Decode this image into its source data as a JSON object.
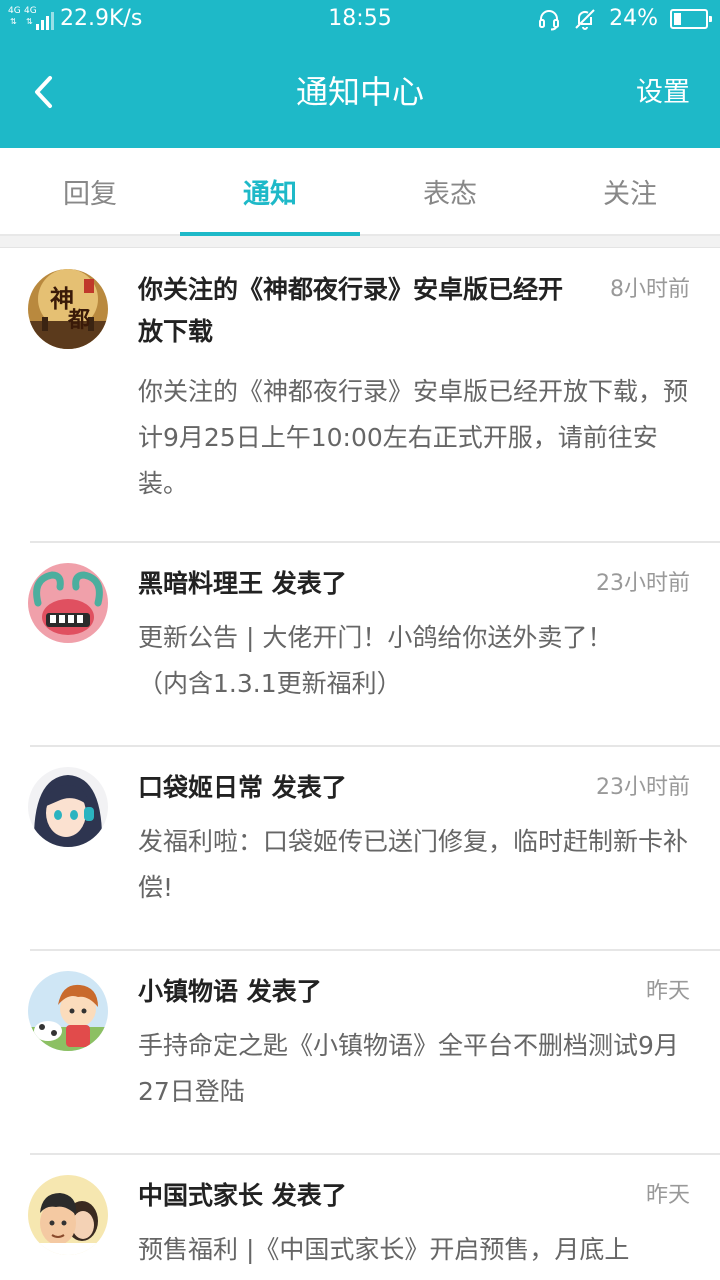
{
  "status_bar": {
    "network_1": "4G",
    "network_2": "4G",
    "net_speed": "22.9K/s",
    "time": "18:55",
    "battery_percent": "24%",
    "battery_level": 0.24,
    "icons": [
      "headset-icon",
      "silent-bell-icon",
      "battery-icon"
    ]
  },
  "header": {
    "back_icon": "chevron-left-icon",
    "title": "通知中心",
    "settings_label": "设置"
  },
  "colors": {
    "accent": "#1EB9C8",
    "title_text": "#222222",
    "body_text": "#666666",
    "time_text": "#999999"
  },
  "tabs": [
    {
      "label": "回复",
      "active": false
    },
    {
      "label": "通知",
      "active": true
    },
    {
      "label": "表态",
      "active": false
    },
    {
      "label": "关注",
      "active": false
    }
  ],
  "notifications": [
    {
      "avatar": "shendu-game-avatar",
      "title": "你关注的《神都夜行录》安卓版已经开放下载",
      "time": "8小时前",
      "body": "你关注的《神都夜行录》安卓版已经开放下载，预计9月25日上午10:00左右正式开服，请前往安装。"
    },
    {
      "avatar": "dark-chef-game-avatar",
      "title": "黑暗料理王 发表了",
      "time": "23小时前",
      "body": "更新公告 | 大佬开门！小鸽给你送外卖了！（内含1.3.1更新福利）"
    },
    {
      "avatar": "pocket-princess-game-avatar",
      "title": "口袋姬日常 发表了",
      "time": "23小时前",
      "body": "发福利啦：口袋姬传已送门修复，临时赶制新卡补偿!"
    },
    {
      "avatar": "town-story-game-avatar",
      "title": "小镇物语 发表了",
      "time": "昨天",
      "body": "手持命定之匙《小镇物语》全平台不删档测试9月27日登陆"
    },
    {
      "avatar": "chinese-parents-game-avatar",
      "title": "中国式家长 发表了",
      "time": "昨天",
      "body": "预售福利 |《中国式家长》开启预售，月底上"
    }
  ]
}
